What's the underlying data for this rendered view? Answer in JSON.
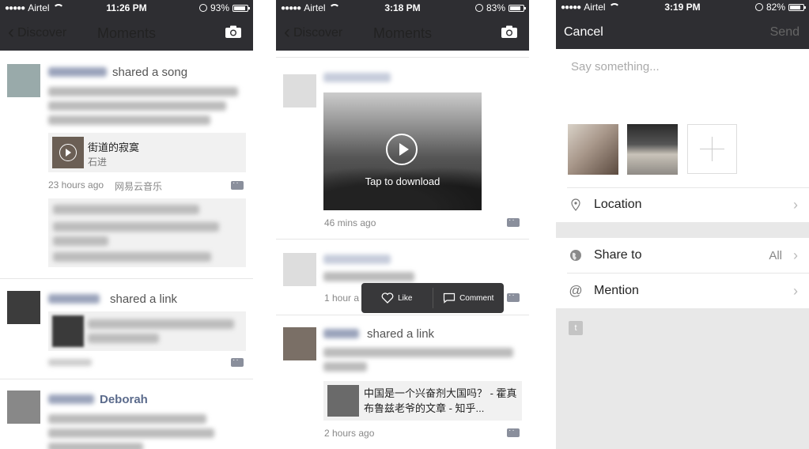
{
  "phone1": {
    "status": {
      "carrier": "Airtel",
      "time": "11:26 PM",
      "battery": "93%",
      "battery_level": 0.93
    },
    "nav": {
      "back_label": "Discover",
      "title": "Moments"
    },
    "post1": {
      "shared_label": "shared a song",
      "song_title": "街道的寂寞",
      "song_artist": "石进",
      "time": "23 hours ago",
      "source": "网易云音乐"
    },
    "post2": {
      "shared_label": "shared a link"
    },
    "post3": {
      "name": "Deborah"
    }
  },
  "phone2": {
    "status": {
      "carrier": "Airtel",
      "time": "3:18 PM",
      "battery": "83%",
      "battery_level": 0.83
    },
    "nav": {
      "back_label": "Discover",
      "title": "Moments"
    },
    "video_post": {
      "tap_label": "Tap to download",
      "time": "46 mins ago"
    },
    "post2": {
      "time": "1 hour a"
    },
    "popup": {
      "like_label": "Like",
      "comment_label": "Comment"
    },
    "link_post": {
      "shared_label": "shared a link",
      "link_title": "中国是一个兴奋剂大国吗？ - 霍真布鲁兹老爷的文章 - 知乎...",
      "time": "2 hours ago"
    }
  },
  "phone3": {
    "status": {
      "carrier": "Airtel",
      "time": "3:19 PM",
      "battery": "82%",
      "battery_level": 0.82
    },
    "nav": {
      "cancel_label": "Cancel",
      "send_label": "Send"
    },
    "compose": {
      "placeholder": "Say something..."
    },
    "rows": {
      "location": "Location",
      "share_to": "Share to",
      "share_to_value": "All",
      "mention": "Mention"
    }
  }
}
